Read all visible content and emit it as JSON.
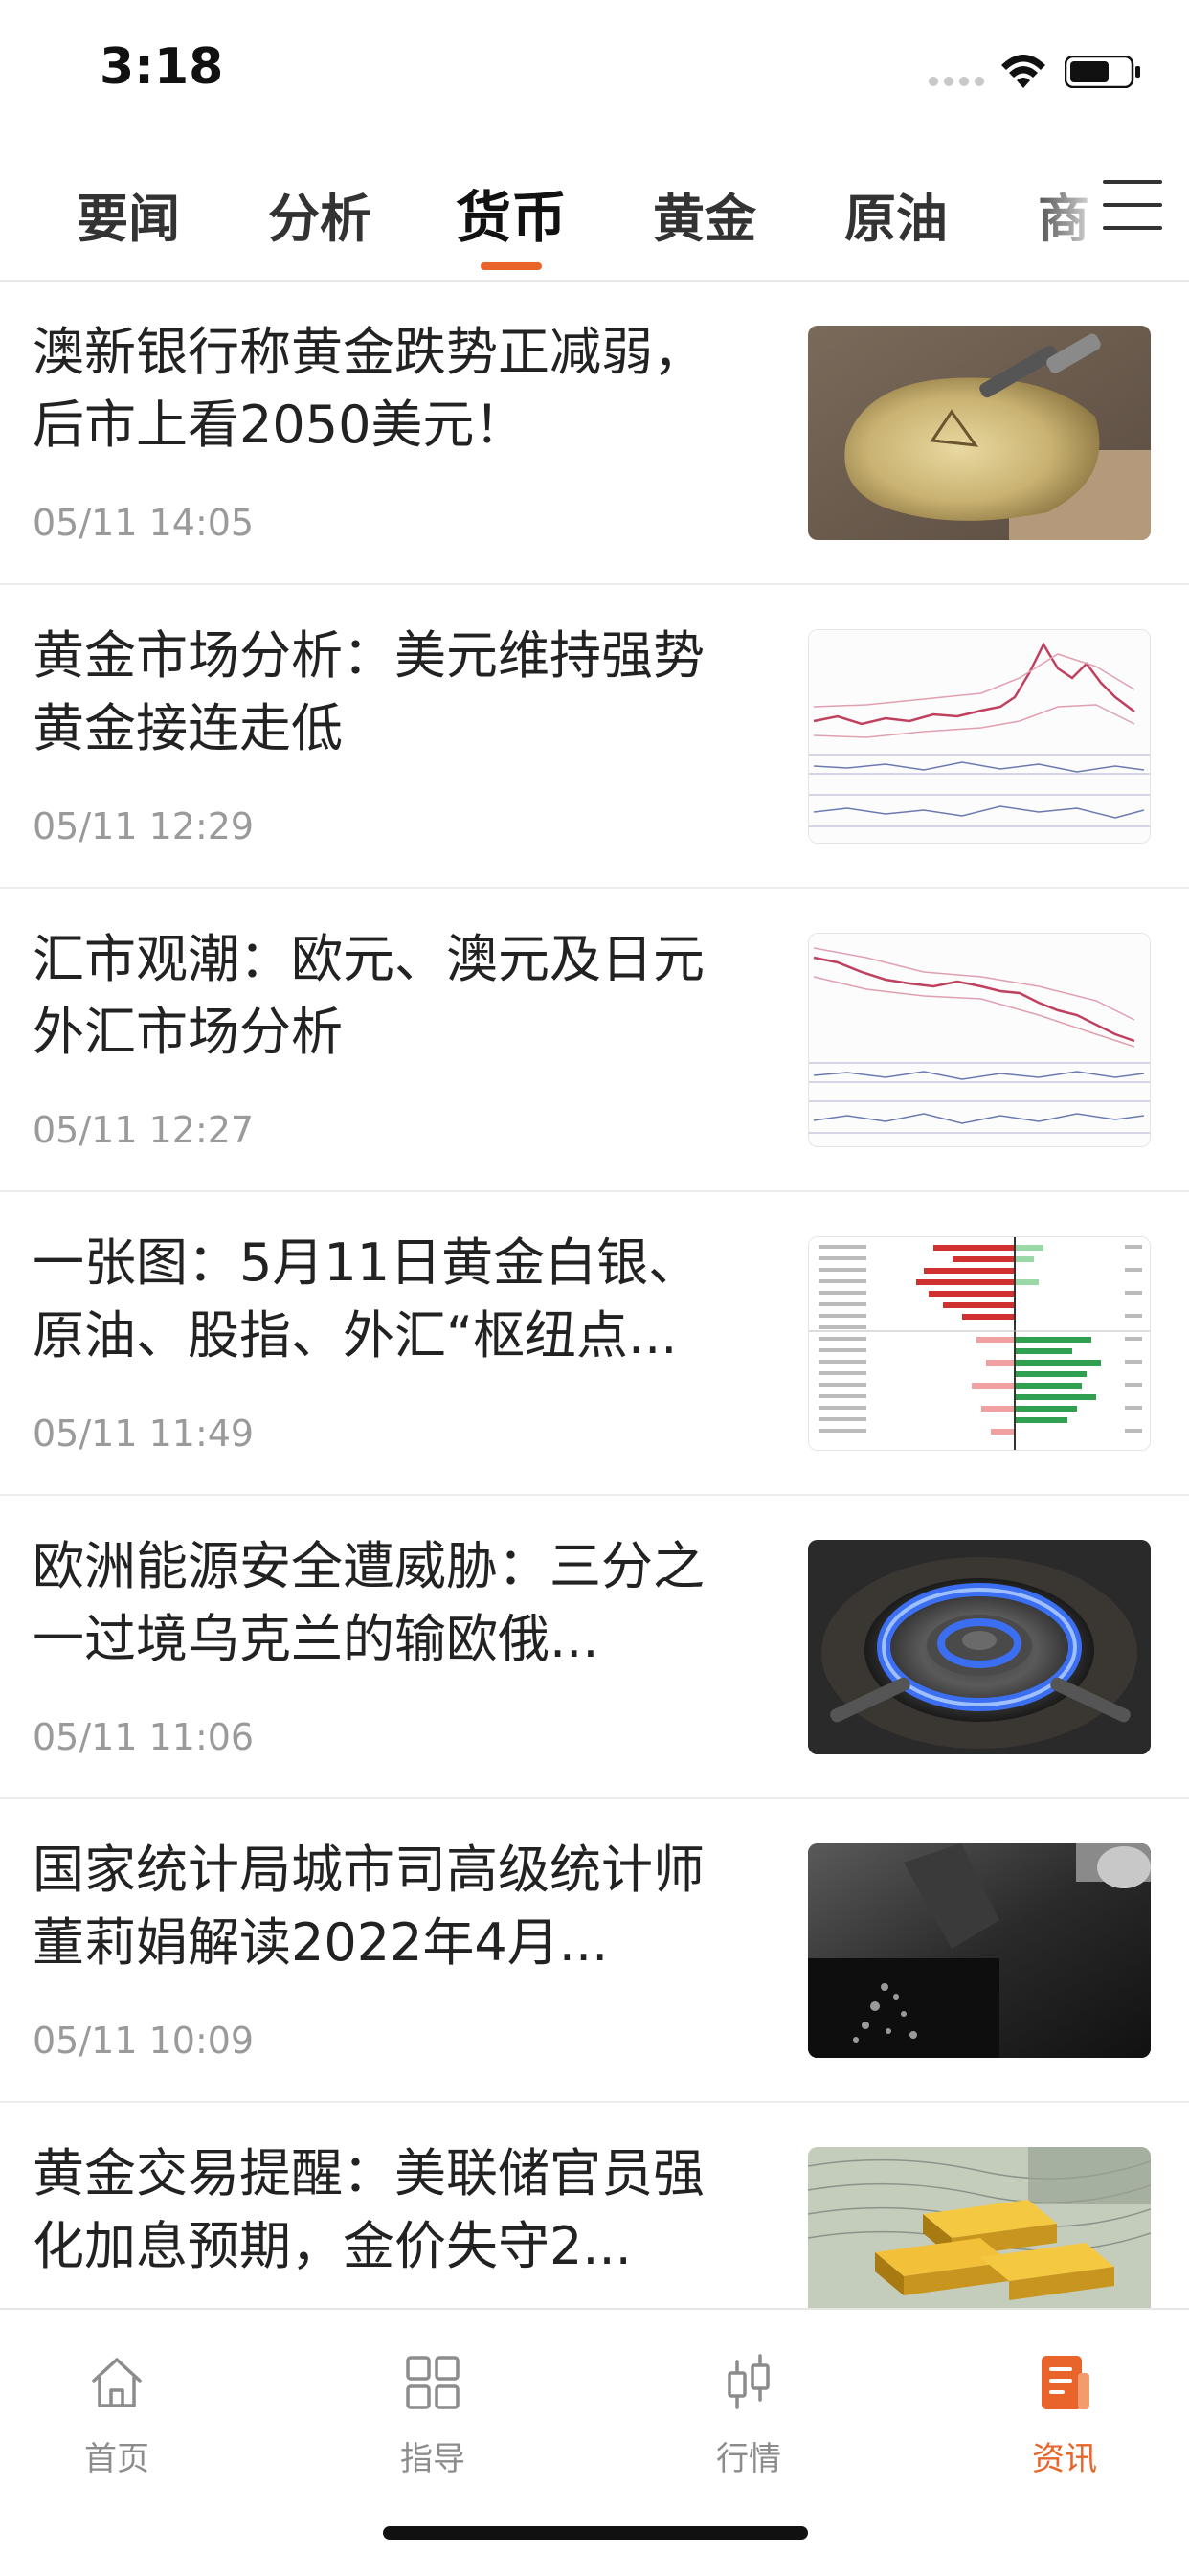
{
  "status": {
    "time": "3:18"
  },
  "tabs": [
    "要闻",
    "分析",
    "货币",
    "黄金",
    "原油",
    "商"
  ],
  "news": [
    {
      "title": "澳新银行称黄金跌势正减弱，后市上看2050美元！",
      "time": "05/11 14:05",
      "thumb": "gold-bar-photo"
    },
    {
      "title": "黄金市场分析：美元维持强势 黄金接连走低",
      "time": "05/11 12:29",
      "thumb": "price-chart"
    },
    {
      "title": "汇市观潮：欧元、澳元及日元外汇市场分析",
      "time": "05/11 12:27",
      "thumb": "price-chart"
    },
    {
      "title": "一张图：5月11日黄金白银、原油、股指、外汇“枢纽点...",
      "time": "05/11 11:49",
      "thumb": "pivot-bar-table"
    },
    {
      "title": "欧洲能源安全遭威胁：三分之一过境乌克兰的输欧俄...",
      "time": "05/11 11:06",
      "thumb": "gas-flame-photo"
    },
    {
      "title": "国家统计局城市司高级统计师董莉娟解读2022年4月...",
      "time": "05/11 10:09",
      "thumb": "coal-photo"
    },
    {
      "title": "黄金交易提醒：美联储官员强化加息预期，金价失守2...",
      "time": "",
      "thumb": "gold-bars-money-photo"
    }
  ],
  "nav": [
    {
      "label": "首页",
      "icon": "home-icon"
    },
    {
      "label": "指导",
      "icon": "grid-icon"
    },
    {
      "label": "行情",
      "icon": "candlestick-icon"
    },
    {
      "label": "资讯",
      "icon": "news-icon"
    }
  ],
  "colors": {
    "accent": "#e8642a",
    "text": "#222222",
    "muted": "#9a9a9a"
  }
}
